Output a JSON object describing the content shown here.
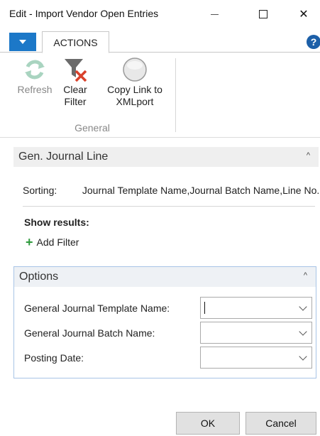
{
  "window": {
    "title": "Edit - Import Vendor Open Entries",
    "min_glyph": "—",
    "close_glyph": "✕"
  },
  "ribbon": {
    "tab_label": "ACTIONS",
    "help_glyph": "?",
    "buttons": [
      {
        "label_line1": "Refresh",
        "label_line2": "",
        "icon": "refresh-icon",
        "enabled": false
      },
      {
        "label_line1": "Clear",
        "label_line2": "Filter",
        "icon": "clear-filter-icon",
        "enabled": true
      },
      {
        "label_line1": "Copy Link to",
        "label_line2": "XMLport",
        "icon": "copy-link-icon",
        "enabled": true
      }
    ],
    "group_label": "General"
  },
  "gen_journal": {
    "header": "Gen. Journal Line",
    "chevron": "^",
    "sorting_label": "Sorting:",
    "sorting_value": "Journal Template Name,Journal Batch Name,Line No.",
    "show_results": "Show results:",
    "add_filter": "Add Filter"
  },
  "options": {
    "header": "Options",
    "chevron": "^",
    "fields": [
      {
        "label": "General Journal Template Name:",
        "value": ""
      },
      {
        "label": "General Journal Batch Name:",
        "value": ""
      },
      {
        "label": "Posting Date:",
        "value": ""
      }
    ]
  },
  "footer": {
    "ok_label": "OK",
    "cancel_label": "Cancel"
  },
  "colors": {
    "accent": "#1c78c8",
    "help": "#1c5fa8",
    "add": "#2e9a3c",
    "clear_x": "#d9412b"
  }
}
